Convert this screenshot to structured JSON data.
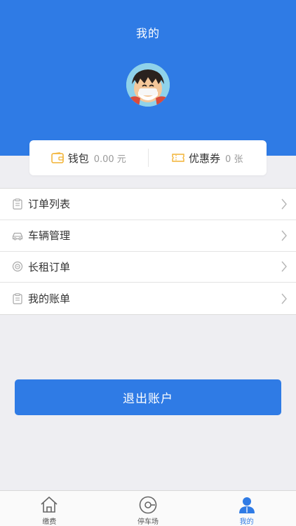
{
  "header": {
    "title": "我的",
    "avatar_icon": "cartoon-avatar-icon"
  },
  "wallet": {
    "label": "钱包",
    "value": "0.00 元",
    "icon": "wallet-icon"
  },
  "coupon": {
    "label": "优惠券",
    "value": "0 张",
    "icon": "ticket-icon"
  },
  "menu": {
    "items": [
      {
        "label": "订单列表",
        "icon": "clipboard-icon"
      },
      {
        "label": "车辆管理",
        "icon": "car-icon"
      },
      {
        "label": "长租订单",
        "icon": "circle-badge-icon"
      },
      {
        "label": "我的账单",
        "icon": "clipboard-icon"
      }
    ]
  },
  "logout": {
    "label": "退出账户"
  },
  "tabbar": {
    "tabs": [
      {
        "label": "缴费",
        "icon": "home-icon",
        "active": false
      },
      {
        "label": "停车场",
        "icon": "parking-icon",
        "active": false
      },
      {
        "label": "我的",
        "icon": "user-icon",
        "active": true
      }
    ]
  },
  "colors": {
    "primary": "#2f7be5",
    "background": "#eeeef2",
    "icon_accent": "#f2b233",
    "text": "#333333",
    "muted": "#9a9a9a"
  }
}
